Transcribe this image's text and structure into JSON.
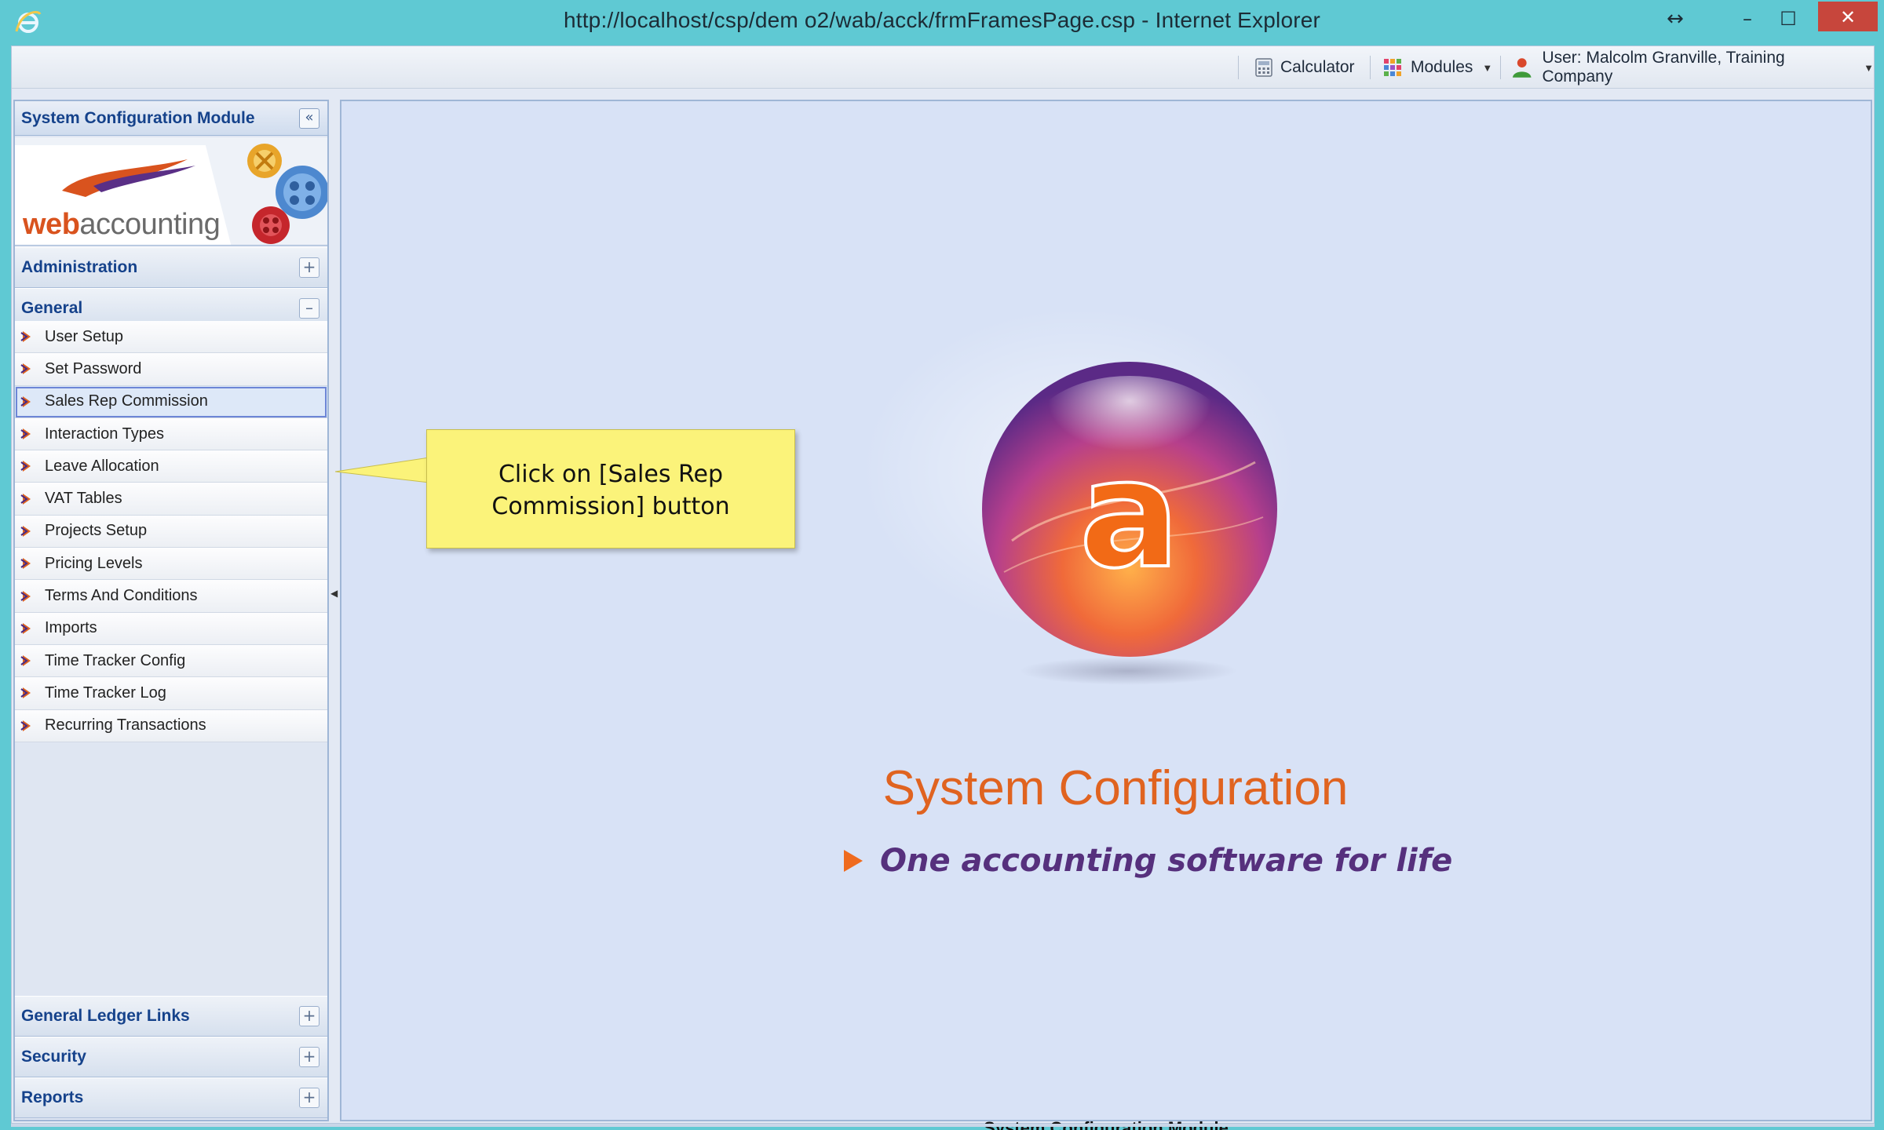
{
  "window": {
    "title": "http://localhost/csp/dem o2/wab/acck/frmFramesPage.csp - Internet Explorer",
    "resize_glyph": "↔",
    "minimize_glyph": "–",
    "maximize_glyph": "☐",
    "close_glyph": "✕"
  },
  "toolbar": {
    "calculator_label": "Calculator",
    "modules_label": "Modules",
    "user_label": "User: Malcolm Granville, Training Company"
  },
  "sidebar": {
    "header_title": "System Configuration Module",
    "collapse_glyph": "«",
    "logo": {
      "prefix": "web",
      "suffix": "accounting"
    },
    "sections": {
      "administration": {
        "title": "Administration",
        "toggle": "+"
      },
      "general": {
        "title": "General",
        "toggle": "–"
      },
      "general_ledger_links": {
        "title": "General Ledger Links",
        "toggle": "+"
      },
      "security": {
        "title": "Security",
        "toggle": "+"
      },
      "reports": {
        "title": "Reports",
        "toggle": "+"
      }
    },
    "general_items": [
      {
        "label": "User Setup"
      },
      {
        "label": "Set Password"
      },
      {
        "label": "Sales Rep Commission"
      },
      {
        "label": "Interaction Types"
      },
      {
        "label": "Leave Allocation"
      },
      {
        "label": "VAT Tables"
      },
      {
        "label": "Projects Setup"
      },
      {
        "label": "Pricing Levels"
      },
      {
        "label": "Terms And Conditions"
      },
      {
        "label": "Imports"
      },
      {
        "label": "Time Tracker Config"
      },
      {
        "label": "Time Tracker Log"
      },
      {
        "label": "Recurring Transactions"
      }
    ],
    "active_item": "Sales Rep Commission"
  },
  "callout": {
    "line1": "Click on [Sales Rep",
    "line2": "Commission] button"
  },
  "main": {
    "orb_letter": "a",
    "title": "System Configuration",
    "tagline": "One accounting software for life",
    "footer": "System Configuration Module"
  },
  "colors": {
    "window_frame": "#5fc9d3",
    "brand_orange": "#e06320",
    "tagline_purple": "#56307d",
    "nav_title_blue": "#15428b",
    "content_bg": "#d8e2f6",
    "callout_yellow": "#fbf37a"
  }
}
